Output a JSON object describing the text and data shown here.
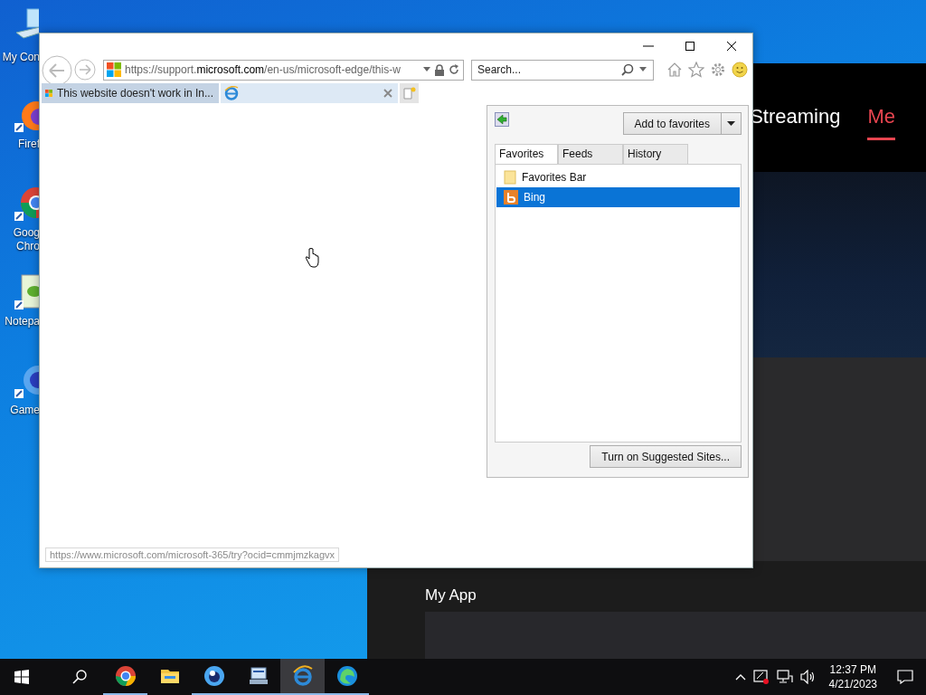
{
  "desktop_icons": [
    {
      "kind": "computer",
      "lines": [
        "My Con"
      ]
    },
    {
      "kind": "firefox",
      "lines": [
        "Firef"
      ]
    },
    {
      "kind": "chrome",
      "lines": [
        "Goog",
        "Chro"
      ]
    },
    {
      "kind": "notepad",
      "lines": [
        "Notepa"
      ]
    },
    {
      "kind": "game",
      "lines": [
        "Game"
      ]
    }
  ],
  "background_app": {
    "nav": [
      {
        "label": "Streaming",
        "selected": false
      },
      {
        "label": "Me",
        "selected": true
      }
    ],
    "section_title": "My App"
  },
  "browser": {
    "address": {
      "prefix": "https://support.",
      "domain": "microsoft.com",
      "suffix": "/en-us/microsoft-edge/this-w"
    },
    "search": {
      "placeholder": "Search..."
    },
    "tabs": [
      {
        "title": "This website doesn't work in In...",
        "kind": "microsoft",
        "selected": true,
        "closable": false
      },
      {
        "kind": "ie",
        "selected": false,
        "closable": true
      }
    ],
    "favorites_pane": {
      "add_button": "Add to favorites",
      "tabs": [
        {
          "label": "Favorites",
          "selected": true
        },
        {
          "label": "Feeds",
          "selected": false
        },
        {
          "label": "History",
          "selected": false
        }
      ],
      "items": [
        {
          "label": "Favorites Bar",
          "kind": "folder",
          "selected": false
        },
        {
          "label": "Bing",
          "kind": "site",
          "selected": true
        }
      ],
      "suggest_button": "Turn on Suggested Sites..."
    },
    "status_url": "https://www.microsoft.com/microsoft-365/try?ocid=cmmjmzkagvx"
  },
  "taskbar": {
    "apps": [
      {
        "kind": "chrome",
        "running": true,
        "selected": false
      },
      {
        "kind": "folder",
        "running": false,
        "selected": false
      },
      {
        "kind": "app",
        "running": true,
        "selected": false
      },
      {
        "kind": "network",
        "running": true,
        "selected": false
      },
      {
        "kind": "ie",
        "running": true,
        "selected": true
      },
      {
        "kind": "edge",
        "running": true,
        "selected": false
      }
    ],
    "time": "12:37 PM",
    "date": "4/21/2023"
  }
}
